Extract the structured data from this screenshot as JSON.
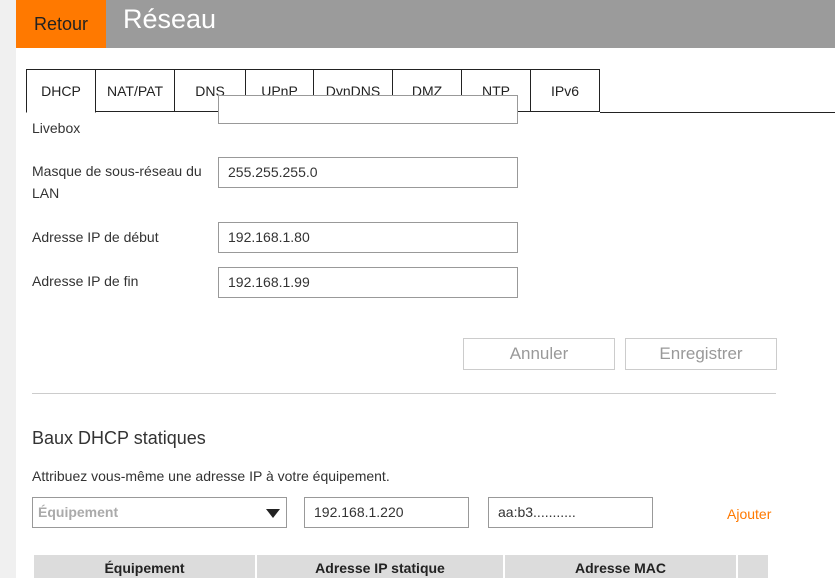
{
  "header": {
    "back_label": "Retour",
    "title": "Réseau",
    "accent_color": "#ff7900",
    "bar_color": "#9b9b9b"
  },
  "tabs": [
    {
      "label": "DHCP",
      "active": true
    },
    {
      "label": "NAT/PAT",
      "active": false
    },
    {
      "label": "DNS",
      "active": false
    },
    {
      "label": "UPnP",
      "active": false
    },
    {
      "label": "DynDNS",
      "active": false
    },
    {
      "label": "DMZ",
      "active": false
    },
    {
      "label": "NTP",
      "active": false
    },
    {
      "label": "IPv6",
      "active": false
    }
  ],
  "form": {
    "livebox_label": "Livebox",
    "livebox_value": "",
    "subnet_label_line1": "Masque de sous-réseau du",
    "subnet_label_line2": "LAN",
    "subnet_value": "255.255.255.0",
    "start_ip_label": "Adresse IP de début",
    "start_ip_value": "192.168.1.80",
    "end_ip_label": "Adresse IP de fin",
    "end_ip_value": "192.168.1.99",
    "cancel_label": "Annuler",
    "save_label": "Enregistrer"
  },
  "static_leases": {
    "title": "Baux DHCP statiques",
    "description": "Attribuez vous-même une adresse IP à votre équipement.",
    "device_select_placeholder": "Équipement",
    "ip_value": "192.168.1.220",
    "mac_value": "aa:b3...........",
    "add_label": "Ajouter",
    "columns": [
      "Équipement",
      "Adresse IP statique",
      "Adresse MAC"
    ]
  }
}
